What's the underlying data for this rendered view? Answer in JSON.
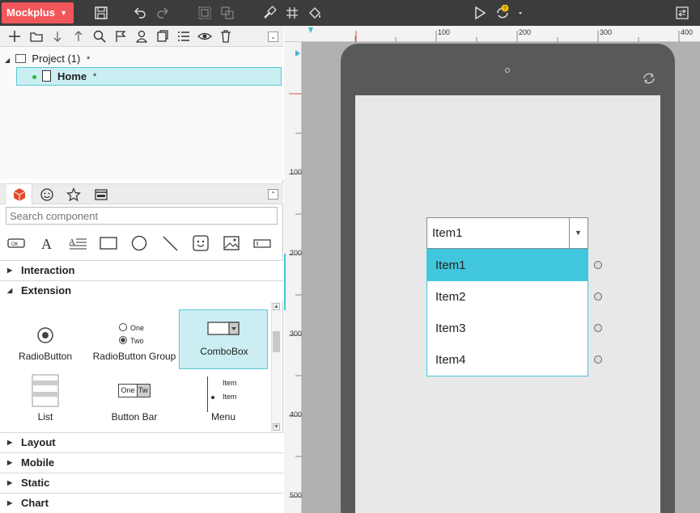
{
  "app": {
    "brand": "Mockplus"
  },
  "pages": {
    "project_label": "Project (1)",
    "project_marker": "*",
    "home_label": "Home",
    "home_marker": "*"
  },
  "components": {
    "search_placeholder": "Search component",
    "categories": {
      "interaction": "Interaction",
      "extension": "Extension",
      "layout": "Layout",
      "mobile": "Mobile",
      "static": "Static",
      "chart": "Chart"
    },
    "items": {
      "radiobutton": "RadioButton",
      "radiobutton_group": "RadioButton Group",
      "radio_one": "One",
      "radio_two": "Two",
      "combobox": "ComboBox",
      "list": "List",
      "button_bar": "Button Bar",
      "button_bar_one": "One",
      "button_bar_two": "Tw",
      "menu": "Menu",
      "menu_item_1": "Item",
      "menu_item_2": "Item"
    }
  },
  "rulers": {
    "top": [
      "100",
      "200",
      "300",
      "400"
    ],
    "left": [
      "100",
      "200",
      "300",
      "400",
      "500"
    ]
  },
  "canvas": {
    "combo_value": "Item1",
    "options": [
      "Item1",
      "Item2",
      "Item3",
      "Item4"
    ],
    "selected_option": "Item1"
  },
  "colors": {
    "brand": "#f2565a",
    "accent": "#41c7dd",
    "selection_bg": "#cbeef3",
    "toolbar_bg": "#3c3c3c",
    "device_frame": "#595959"
  }
}
